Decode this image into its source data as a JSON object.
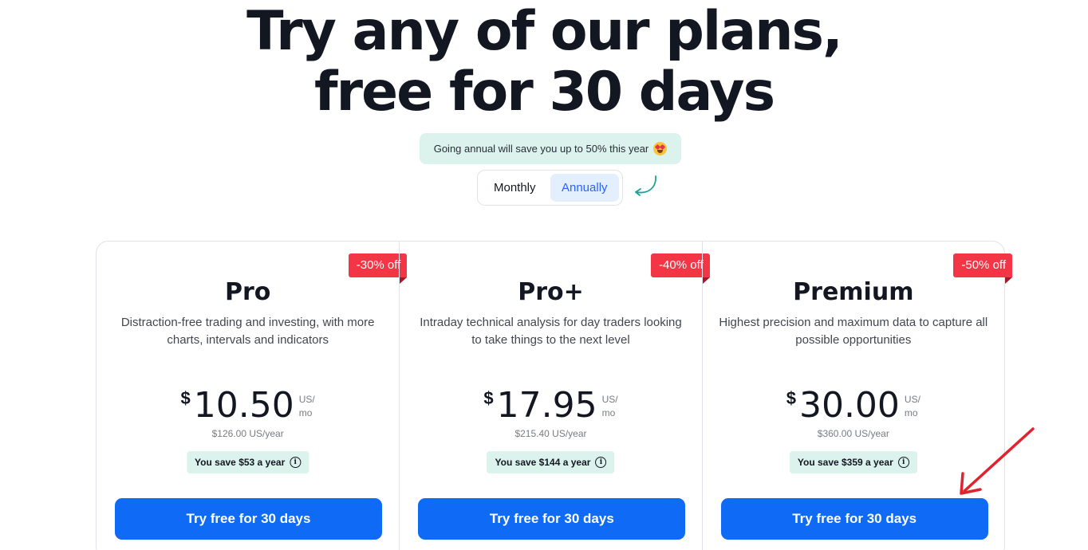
{
  "headline": {
    "line1": "Try any of our plans,",
    "line2": "free for 30 days"
  },
  "annual_note": {
    "text": "Going annual will save you up to 50% this year",
    "emoji": "heart-eyes-emoji"
  },
  "billing_toggle": {
    "monthly": "Monthly",
    "annually": "Annually",
    "selected": "Annually"
  },
  "plans": [
    {
      "name": "Pro",
      "badge": "-30% off",
      "description": "Distraction-free trading and investing, with more charts, intervals and indicators",
      "currency": "$",
      "price": "10.50",
      "unit_line1": "US/",
      "unit_line2": "mo",
      "yearly": "$126.00 US/year",
      "save": "You save $53 a year",
      "cta": "Try free for 30 days"
    },
    {
      "name": "Pro+",
      "badge": "-40% off",
      "description": "Intraday technical analysis for day traders looking to take things to the next level",
      "currency": "$",
      "price": "17.95",
      "unit_line1": "US/",
      "unit_line2": "mo",
      "yearly": "$215.40 US/year",
      "save": "You save $144 a year",
      "cta": "Try free for 30 days"
    },
    {
      "name": "Premium",
      "badge": "-50% off",
      "description": "Highest precision and maximum data to capture all possible opportunities",
      "currency": "$",
      "price": "30.00",
      "unit_line1": "US/",
      "unit_line2": "mo",
      "yearly": "$360.00 US/year",
      "save": "You save $359 a year",
      "cta": "Try free for 30 days"
    }
  ],
  "colors": {
    "accent": "#0f6af5",
    "badge": "#f23645",
    "mint": "#dcf2ec",
    "annotation_arrow": "#e0242f"
  }
}
